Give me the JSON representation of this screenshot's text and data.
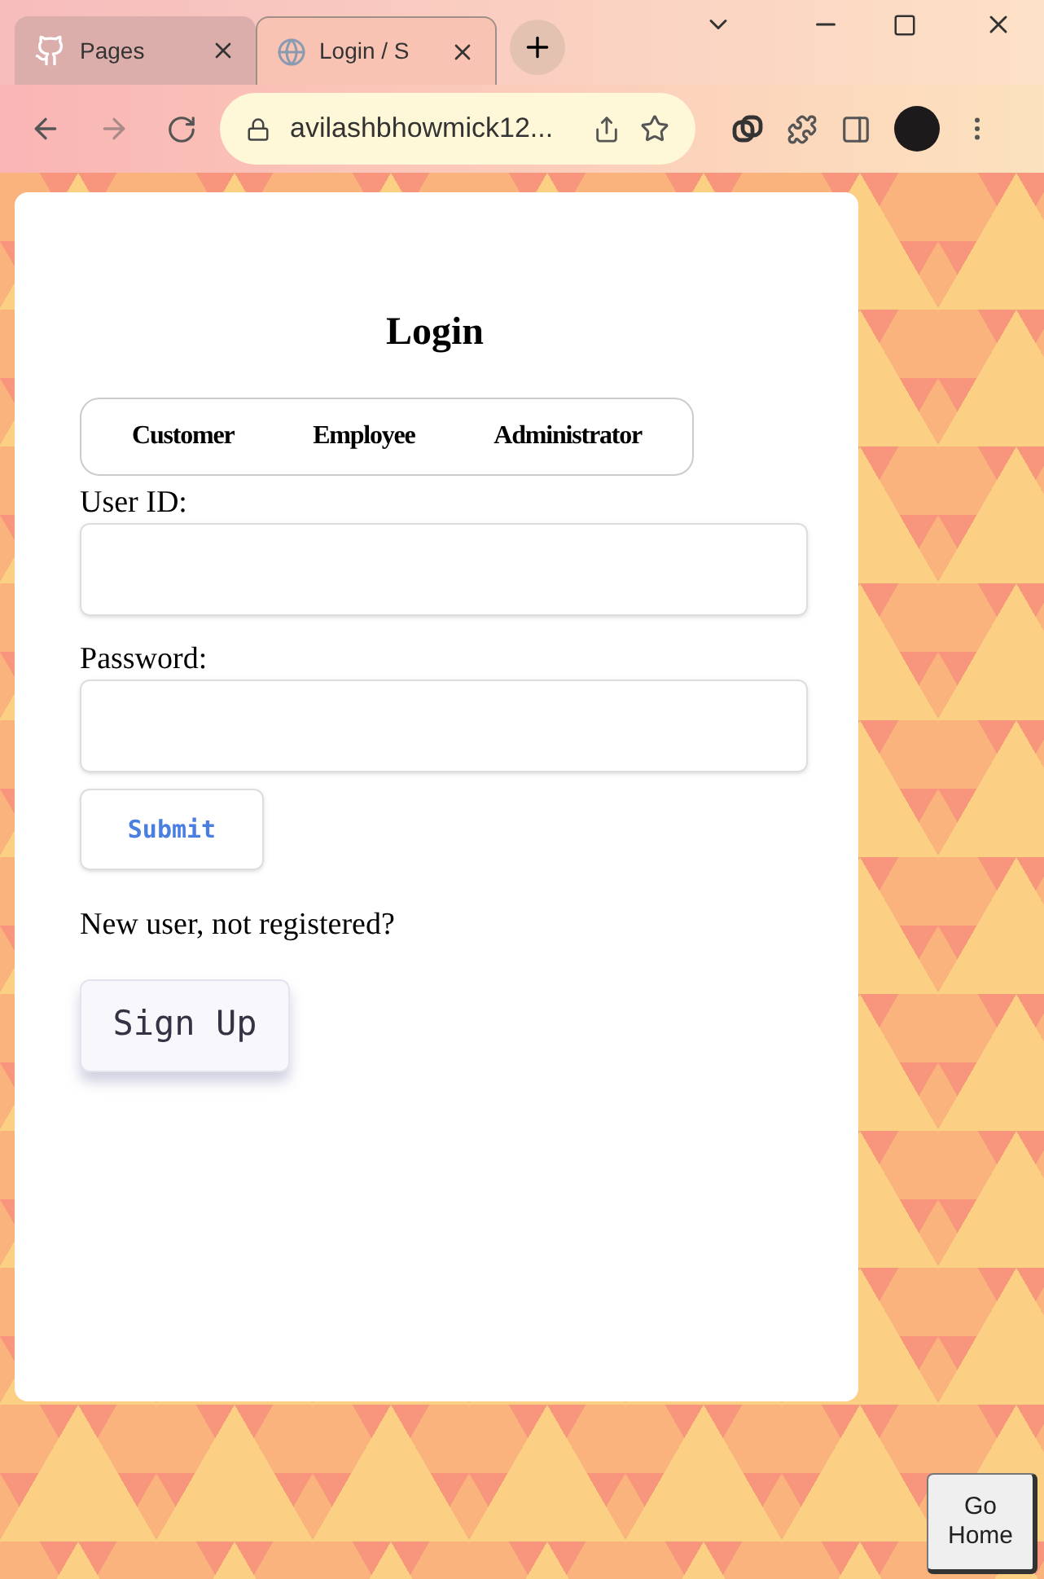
{
  "browser": {
    "tabs": [
      {
        "title": "Pages",
        "selected": false
      },
      {
        "title": "Login / S",
        "selected": true
      }
    ],
    "address": "avilashbhowmick12..."
  },
  "login": {
    "title": "Login",
    "roles": [
      "Customer",
      "Employee",
      "Administrator"
    ],
    "fields": [
      {
        "label": "User ID:"
      },
      {
        "label": "Password:"
      }
    ],
    "submit": "Submit",
    "prompt": "New user, not registered?",
    "signup": "Sign Up"
  },
  "go_home": "Go Home"
}
